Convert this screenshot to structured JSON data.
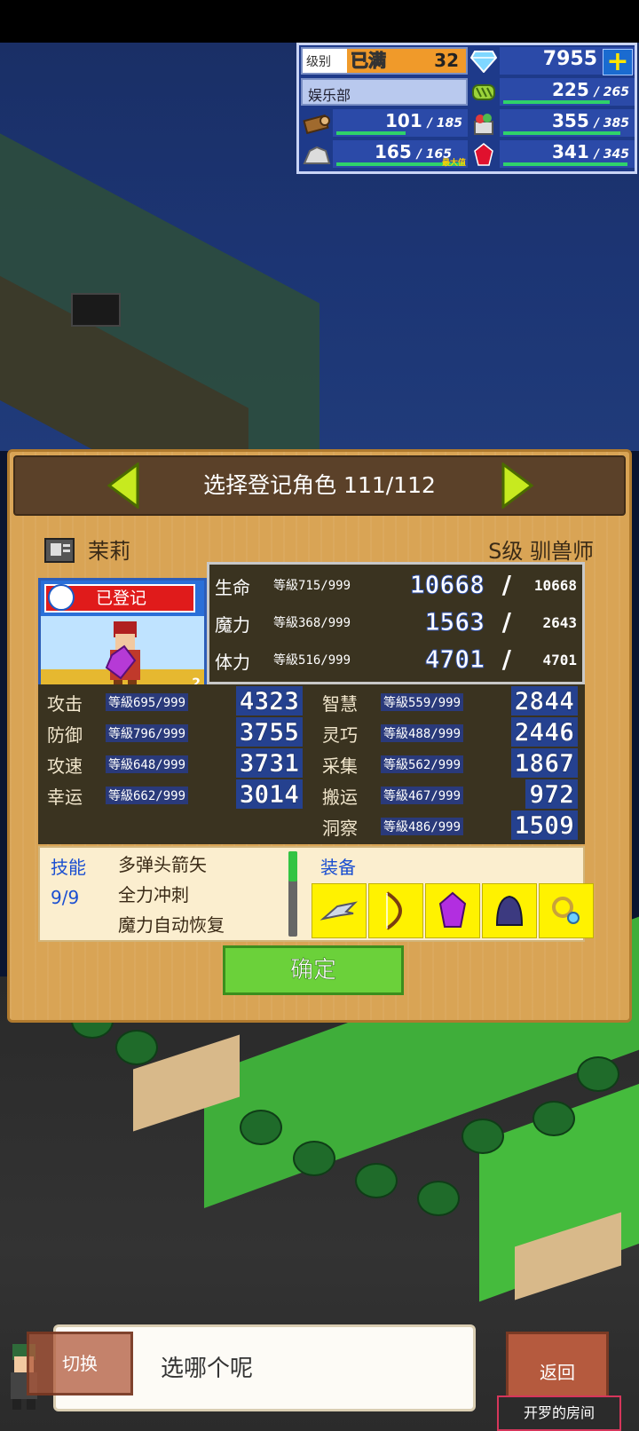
{
  "hud": {
    "level_label": "级别",
    "level_max_badge": "已满",
    "level_value": "32",
    "gems": "7955",
    "plus_label": "+",
    "club_name": "娱乐部",
    "resources": [
      {
        "icon": "grass-icon",
        "value": "225",
        "max": "265",
        "fill": 0.85
      },
      {
        "icon": "wood-log-icon",
        "value": "101",
        "max": "185",
        "fill": 0.55
      },
      {
        "icon": "food-basket-icon",
        "value": "355",
        "max": "385",
        "fill": 0.92
      },
      {
        "icon": "ore-icon",
        "value": "165",
        "max": "165",
        "fill": 1.0,
        "max_tag": "最大值"
      },
      {
        "icon": "red-gem-icon",
        "value": "341",
        "max": "345",
        "fill": 0.98
      }
    ]
  },
  "panel": {
    "title": "选择登记角色 111/112",
    "char_name": "茉莉",
    "char_rank": "S级 驯兽师",
    "registered_tag": "已登记",
    "level_badge": "2",
    "top_stats": [
      {
        "label": "生命",
        "lvl": "等級715/999",
        "value": "10668",
        "max": "10668"
      },
      {
        "label": "魔力",
        "lvl": "等級368/999",
        "value": "1563",
        "max": "2643"
      },
      {
        "label": "体力",
        "lvl": "等級516/999",
        "value": "4701",
        "max": "4701"
      }
    ],
    "stats_left": [
      {
        "label": "攻击",
        "lvl": "等級695/999",
        "value": "4323"
      },
      {
        "label": "防御",
        "lvl": "等級796/999",
        "value": "3755"
      },
      {
        "label": "攻速",
        "lvl": "等級648/999",
        "value": "3731"
      },
      {
        "label": "幸运",
        "lvl": "等級662/999",
        "value": "3014"
      }
    ],
    "stats_right": [
      {
        "label": "智慧",
        "lvl": "等級559/999",
        "value": "2844"
      },
      {
        "label": "灵巧",
        "lvl": "等級488/999",
        "value": "2446"
      },
      {
        "label": "采集",
        "lvl": "等級562/999",
        "value": "1867"
      },
      {
        "label": "搬运",
        "lvl": "等級467/999",
        "value": "972"
      },
      {
        "label": "洞察",
        "lvl": "等級486/999",
        "value": "1509"
      }
    ],
    "skill_title": "技能",
    "skill_count": "9/9",
    "skills": [
      "多弹头箭矢",
      "全力冲刺",
      "魔力自动恢复"
    ],
    "equip_title": "装备",
    "equipment": [
      "claw-weapon-icon",
      "bow-icon",
      "purple-crystal-icon",
      "dark-hood-icon",
      "ring-icon"
    ],
    "confirm_label": "确定"
  },
  "dialog": {
    "text": "选哪个呢",
    "switch_label": "切换",
    "back_label": "返回",
    "room_label": "开罗的房间"
  }
}
